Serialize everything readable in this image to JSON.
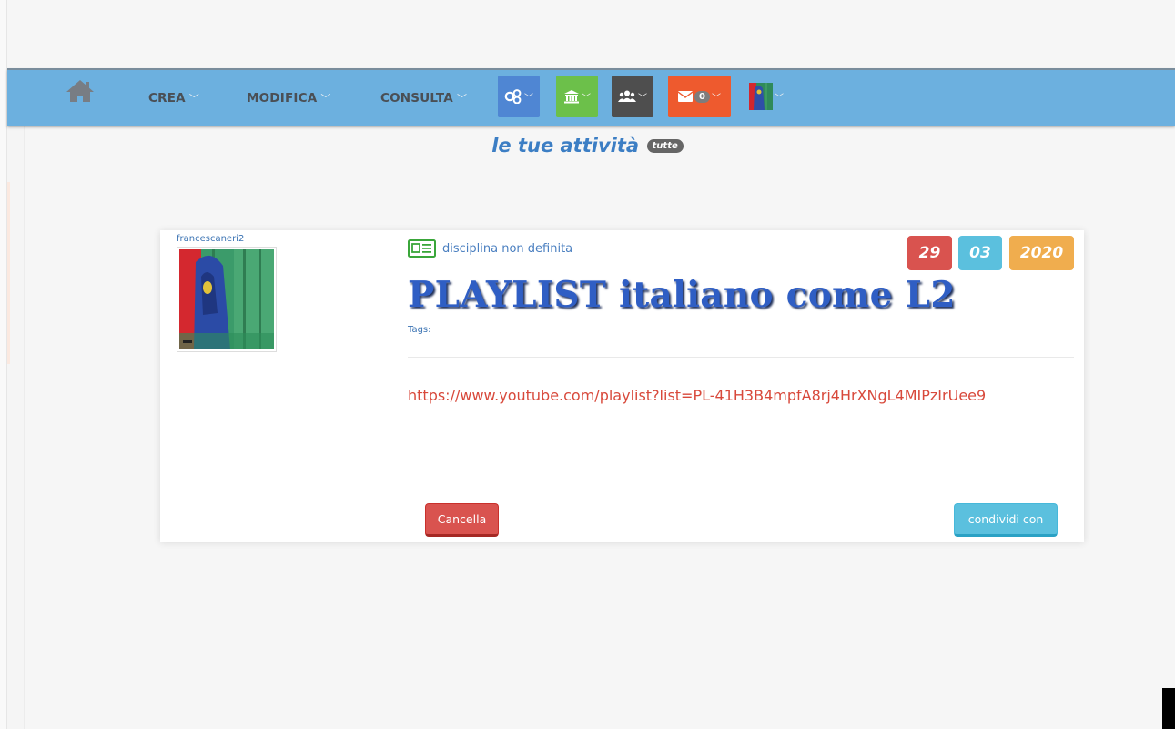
{
  "navbar": {
    "menus": [
      {
        "label": "CREA"
      },
      {
        "label": "MODIFICA"
      },
      {
        "label": "CONSULTA"
      }
    ],
    "buttons": [
      {
        "icon": "share-icon",
        "color": "#4f86d3"
      },
      {
        "icon": "institution-icon",
        "color": "#6cc04a"
      },
      {
        "icon": "group-icon",
        "color": "#4e4e4e"
      },
      {
        "icon": "envelope-icon",
        "color": "#ee5a2e",
        "count": "0"
      },
      {
        "icon": "user-avatar",
        "color": "#6cb0df"
      }
    ],
    "colors": {
      "bar": "#6cb0df",
      "home_icon": "#7a7f86"
    }
  },
  "section": {
    "title": "le tue attività",
    "all_badge": "tutte"
  },
  "card": {
    "username": "francescaneri2",
    "discipline": "disciplina non definita",
    "date": {
      "day": "29",
      "month": "03",
      "year": "2020"
    },
    "date_colors": {
      "day": "#d9534f",
      "month": "#5bc0de",
      "year": "#f0ad4e"
    },
    "title": "PLAYLIST italiano come L2",
    "tags_label": "Tags:",
    "link": "https://www.youtube.com/playlist?list=PL-41H3B4mpfA8rj4HrXNgL4MIPzIrUee9",
    "delete_label": "Cancella",
    "share_label": "condividi con"
  }
}
